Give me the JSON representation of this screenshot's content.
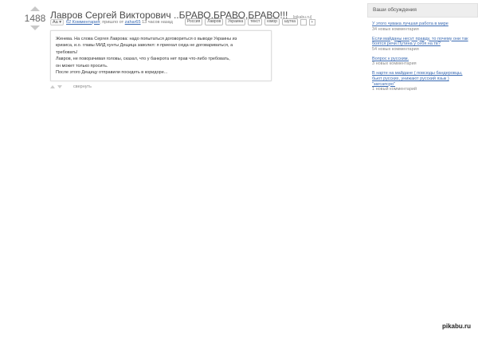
{
  "post": {
    "rating": "1488",
    "title": "Лавров Сергей Викторович ..БРАВО,БРАВО,БРАВО!!!",
    "source": "[pikabu.ru]",
    "font_button": "Aa ▾",
    "comments_link": "62 Комментария",
    "posted_prefix": "; пришло от",
    "author": "zahar65",
    "time_ago": "13 часов назад",
    "tags": [
      "Россия",
      "Лавров",
      "Украина",
      "текст",
      "юмор",
      "шутка"
    ],
    "body_lines": [
      "Женева. На слова Сергея Лаврова: надо попытаться договориться о выводе Украины из",
      "кризиса, и.о. главы МИД хунты Дещица заволил: я приехал сюда не договариваться, а",
      "требовать!",
      "Лавров, не поворачивая головы, сказал, что у банкрота нет прав что-либо требовать,",
      "он может только просить.",
      "После этого Дещицу отправили посидеть в коридоре..."
    ],
    "collapse_label": "свернуть"
  },
  "sidebar": {
    "header": "Ваши обсуждения",
    "items": [
      {
        "title": "У этого чувака лучшая работа в мире",
        "count": "34 новых комментария"
      },
      {
        "title": "Если майданы несут правду, то почему они так боятся речи Путина у себя на тв?",
        "count": "54 новых комментария"
      },
      {
        "title": "Вопрос к русским.",
        "count": "3 новых комментария"
      },
      {
        "title": "В нарте на майдане ( повсюды бандеровцы, бьют русских, унижают русский язык ) \"загсапсро\"",
        "count": "1 новый комментарий"
      }
    ]
  },
  "watermark": "pikabu.ru"
}
